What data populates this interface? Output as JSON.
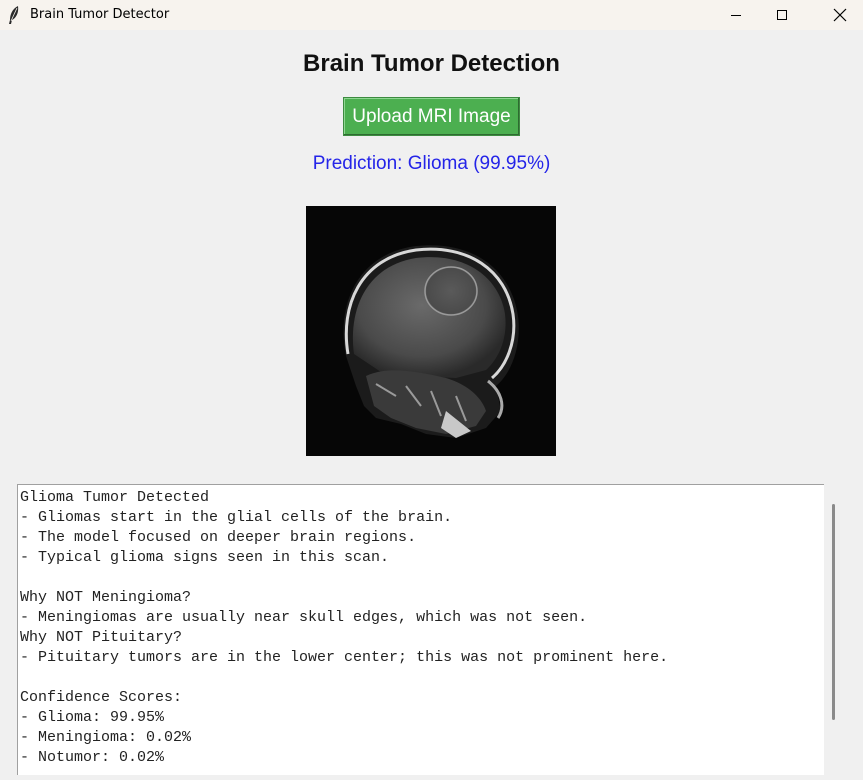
{
  "window": {
    "title": "Brain Tumor Detector",
    "icons": {
      "app": "feather-icon",
      "minimize": "minimize-icon",
      "maximize": "maximize-icon",
      "close": "close-icon"
    }
  },
  "main": {
    "heading": "Brain Tumor Detection",
    "upload_label": "Upload MRI Image",
    "prediction": "Prediction: Glioma (99.95%)"
  },
  "report": {
    "lines": [
      "Glioma Tumor Detected",
      "- Gliomas start in the glial cells of the brain.",
      "- The model focused on deeper brain regions.",
      "- Typical glioma signs seen in this scan.",
      "",
      "Why NOT Meningioma?",
      "- Meningiomas are usually near skull edges, which was not seen.",
      "Why NOT Pituitary?",
      "- Pituitary tumors are in the lower center; this was not prominent here.",
      "",
      "Confidence Scores:",
      "- Glioma: 99.95%",
      "- Meningioma: 0.02%",
      "- Notumor: 0.02%"
    ]
  },
  "colors": {
    "button_green": "#4caf50",
    "prediction_blue": "#2424e8",
    "background": "#f0f0f0"
  }
}
